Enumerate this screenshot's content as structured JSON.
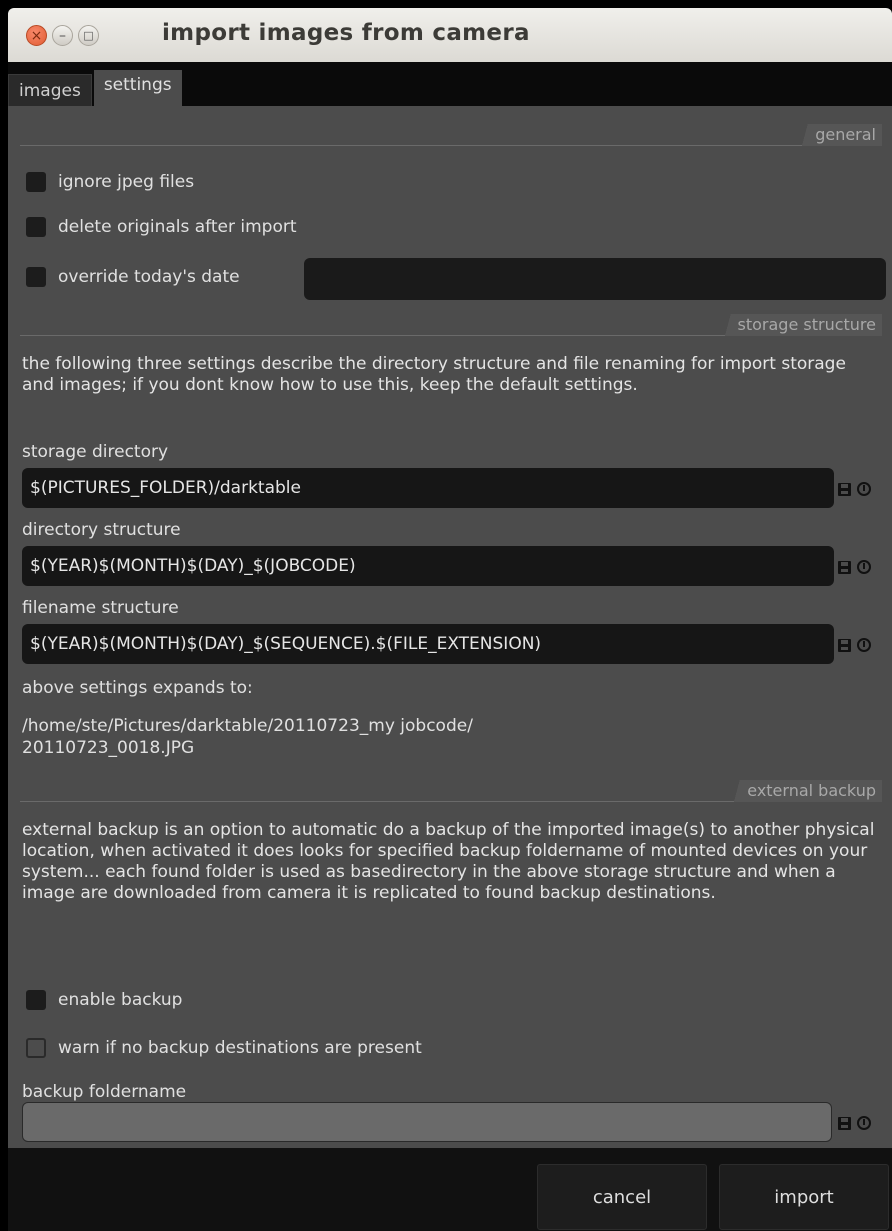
{
  "window": {
    "title": "import images from camera",
    "close_glyph": "×",
    "minimize_glyph": "–",
    "maximize_glyph": "□"
  },
  "tabs": [
    {
      "label": "images",
      "active": false
    },
    {
      "label": "settings",
      "active": true
    }
  ],
  "general": {
    "header": "general",
    "ignore_jpeg": "ignore jpeg files",
    "delete_originals": "delete originals after import",
    "override_date": "override today's date",
    "override_date_value": ""
  },
  "storage": {
    "header": "storage structure",
    "description": "the following three settings describe the directory structure and file renaming for import storage and images; if you dont know how to use this, keep the default settings.",
    "storage_directory_label": "storage directory",
    "storage_directory_value": "$(PICTURES_FOLDER)/darktable",
    "directory_structure_label": "directory structure",
    "directory_structure_value": "$(YEAR)$(MONTH)$(DAY)_$(JOBCODE)",
    "filename_structure_label": "filename structure",
    "filename_structure_value": "$(YEAR)$(MONTH)$(DAY)_$(SEQUENCE).$(FILE_EXTENSION)",
    "expands_label": "above settings expands to:",
    "expands_line1": "/home/ste/Pictures/darktable/20110723_my jobcode/",
    "expands_line2": "20110723_0018.JPG"
  },
  "backup": {
    "header": "external backup",
    "description": "external backup is an option to automatic do a backup of the imported image(s) to another physical location, when activated it does looks for specified backup foldername of mounted devices on your system... each found folder is used as basedirectory in the above storage structure and when a image are downloaded from camera it is replicated to found backup destinations.",
    "enable_backup": "enable backup",
    "warn_no_destinations": "warn if no backup destinations are present",
    "foldername_label": "backup foldername",
    "foldername_value": ""
  },
  "footer": {
    "cancel": "cancel",
    "import": "import"
  },
  "icons": {
    "field_save": "save-icon",
    "field_reset": "reset-icon"
  },
  "colors": {
    "panel_bg": "#4c4c4c",
    "field_bg": "#161616",
    "title_bar": "#e6e4de",
    "close_button": "#e8663b"
  }
}
